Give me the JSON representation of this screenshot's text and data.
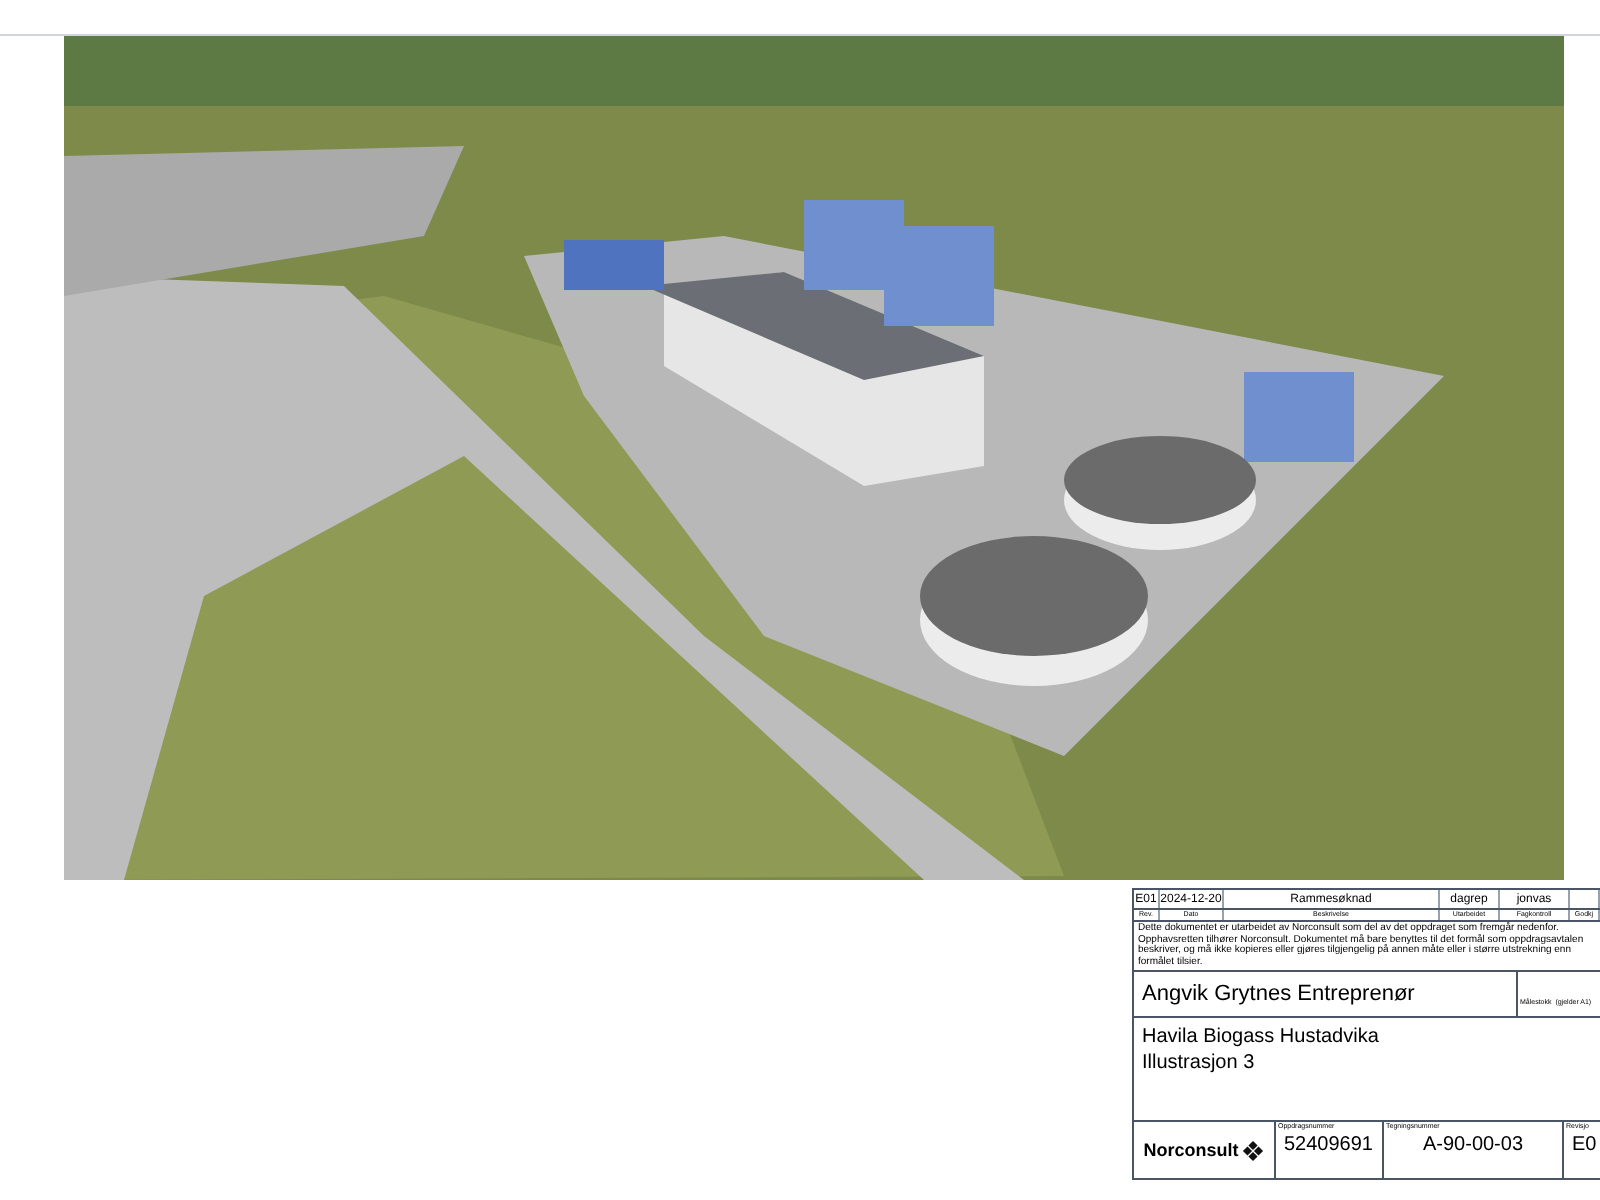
{
  "title_block": {
    "revision_row": {
      "rev": "E01",
      "date": "2024-12-20",
      "description": "Rammesøknad",
      "prepared_by": "dagrep",
      "checked_by": "jonvas"
    },
    "revision_headers": [
      "Rev.",
      "Dato",
      "Beskrivelse",
      "Utarbeidet",
      "Fagkontroll",
      "Godkj"
    ],
    "disclaimer": "Dette dokumentet er utarbeidet av Norconsult som del av det oppdraget som fremgår nedenfor. Opphavsretten tilhører Norconsult. Dokumentet må bare benyttes til det formål som oppdragsavtalen beskriver, og må ikke kopieres eller gjøres tilgjengelig på annen måte eller i større utstrekning enn formålet tilsier.",
    "client": "Angvik Grytnes Entreprenør",
    "scale_label": "Målestokk  (gjelder A1)",
    "project_lines": [
      "Havila Biogass Hustadvika",
      "Illustrasjon 3"
    ],
    "company": "Norconsult",
    "fields": [
      {
        "label": "Oppdragsnummer",
        "value": "52409691"
      },
      {
        "label": "Tegningsnummer",
        "value": "A-90-00-03"
      },
      {
        "label": "Revisjo",
        "value": "E0"
      }
    ]
  }
}
